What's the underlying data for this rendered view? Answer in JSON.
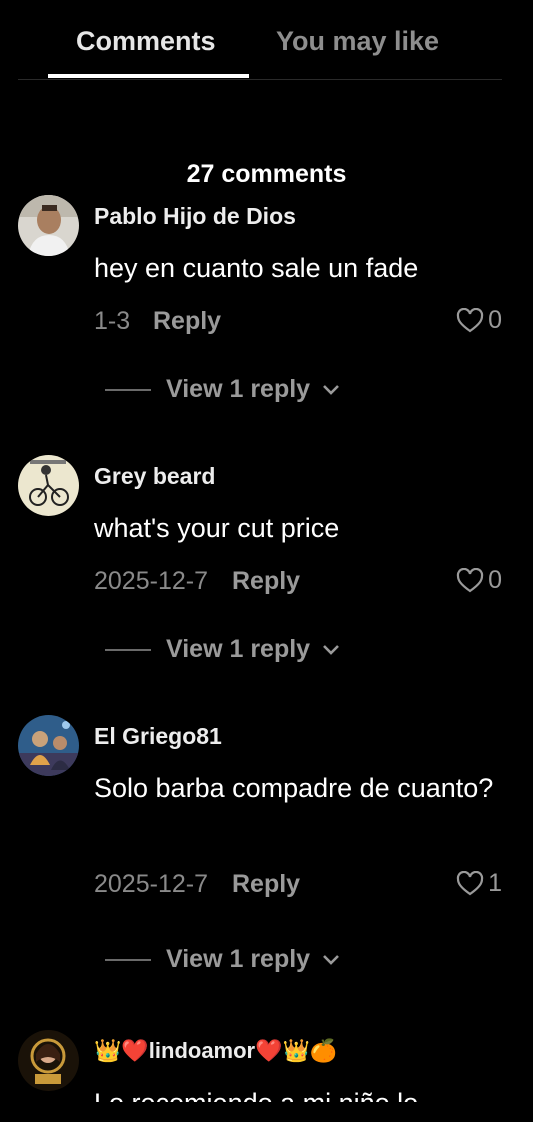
{
  "tabs": {
    "comments": "Comments",
    "you_may_like": "You may like"
  },
  "comment_count": "27 comments",
  "comments": [
    {
      "username": "Pablo Hijo de Dios",
      "text": "hey en cuanto sale un fade",
      "date": "1-3",
      "reply": "Reply",
      "likes": "0",
      "view_replies": "View 1 reply"
    },
    {
      "username": "Grey beard",
      "text": "what's your cut price",
      "date": "2025-12-7",
      "reply": "Reply",
      "likes": "0",
      "view_replies": "View 1 reply"
    },
    {
      "username": "El Griego81",
      "text": "Solo barba compadre de cuanto?",
      "date": "2025-12-7",
      "reply": "Reply",
      "likes": "1",
      "view_replies": "View 1 reply"
    },
    {
      "username": "👑❤️lindoamor❤️👑🍊",
      "text": "Lo recomiendo a mi niño lo"
    }
  ],
  "icons": {
    "like": "heart-outline-icon",
    "expand": "chevron-down-icon"
  },
  "colors": {
    "background": "#000000",
    "text": "#ffffff",
    "muted": "#8a8a8a"
  }
}
